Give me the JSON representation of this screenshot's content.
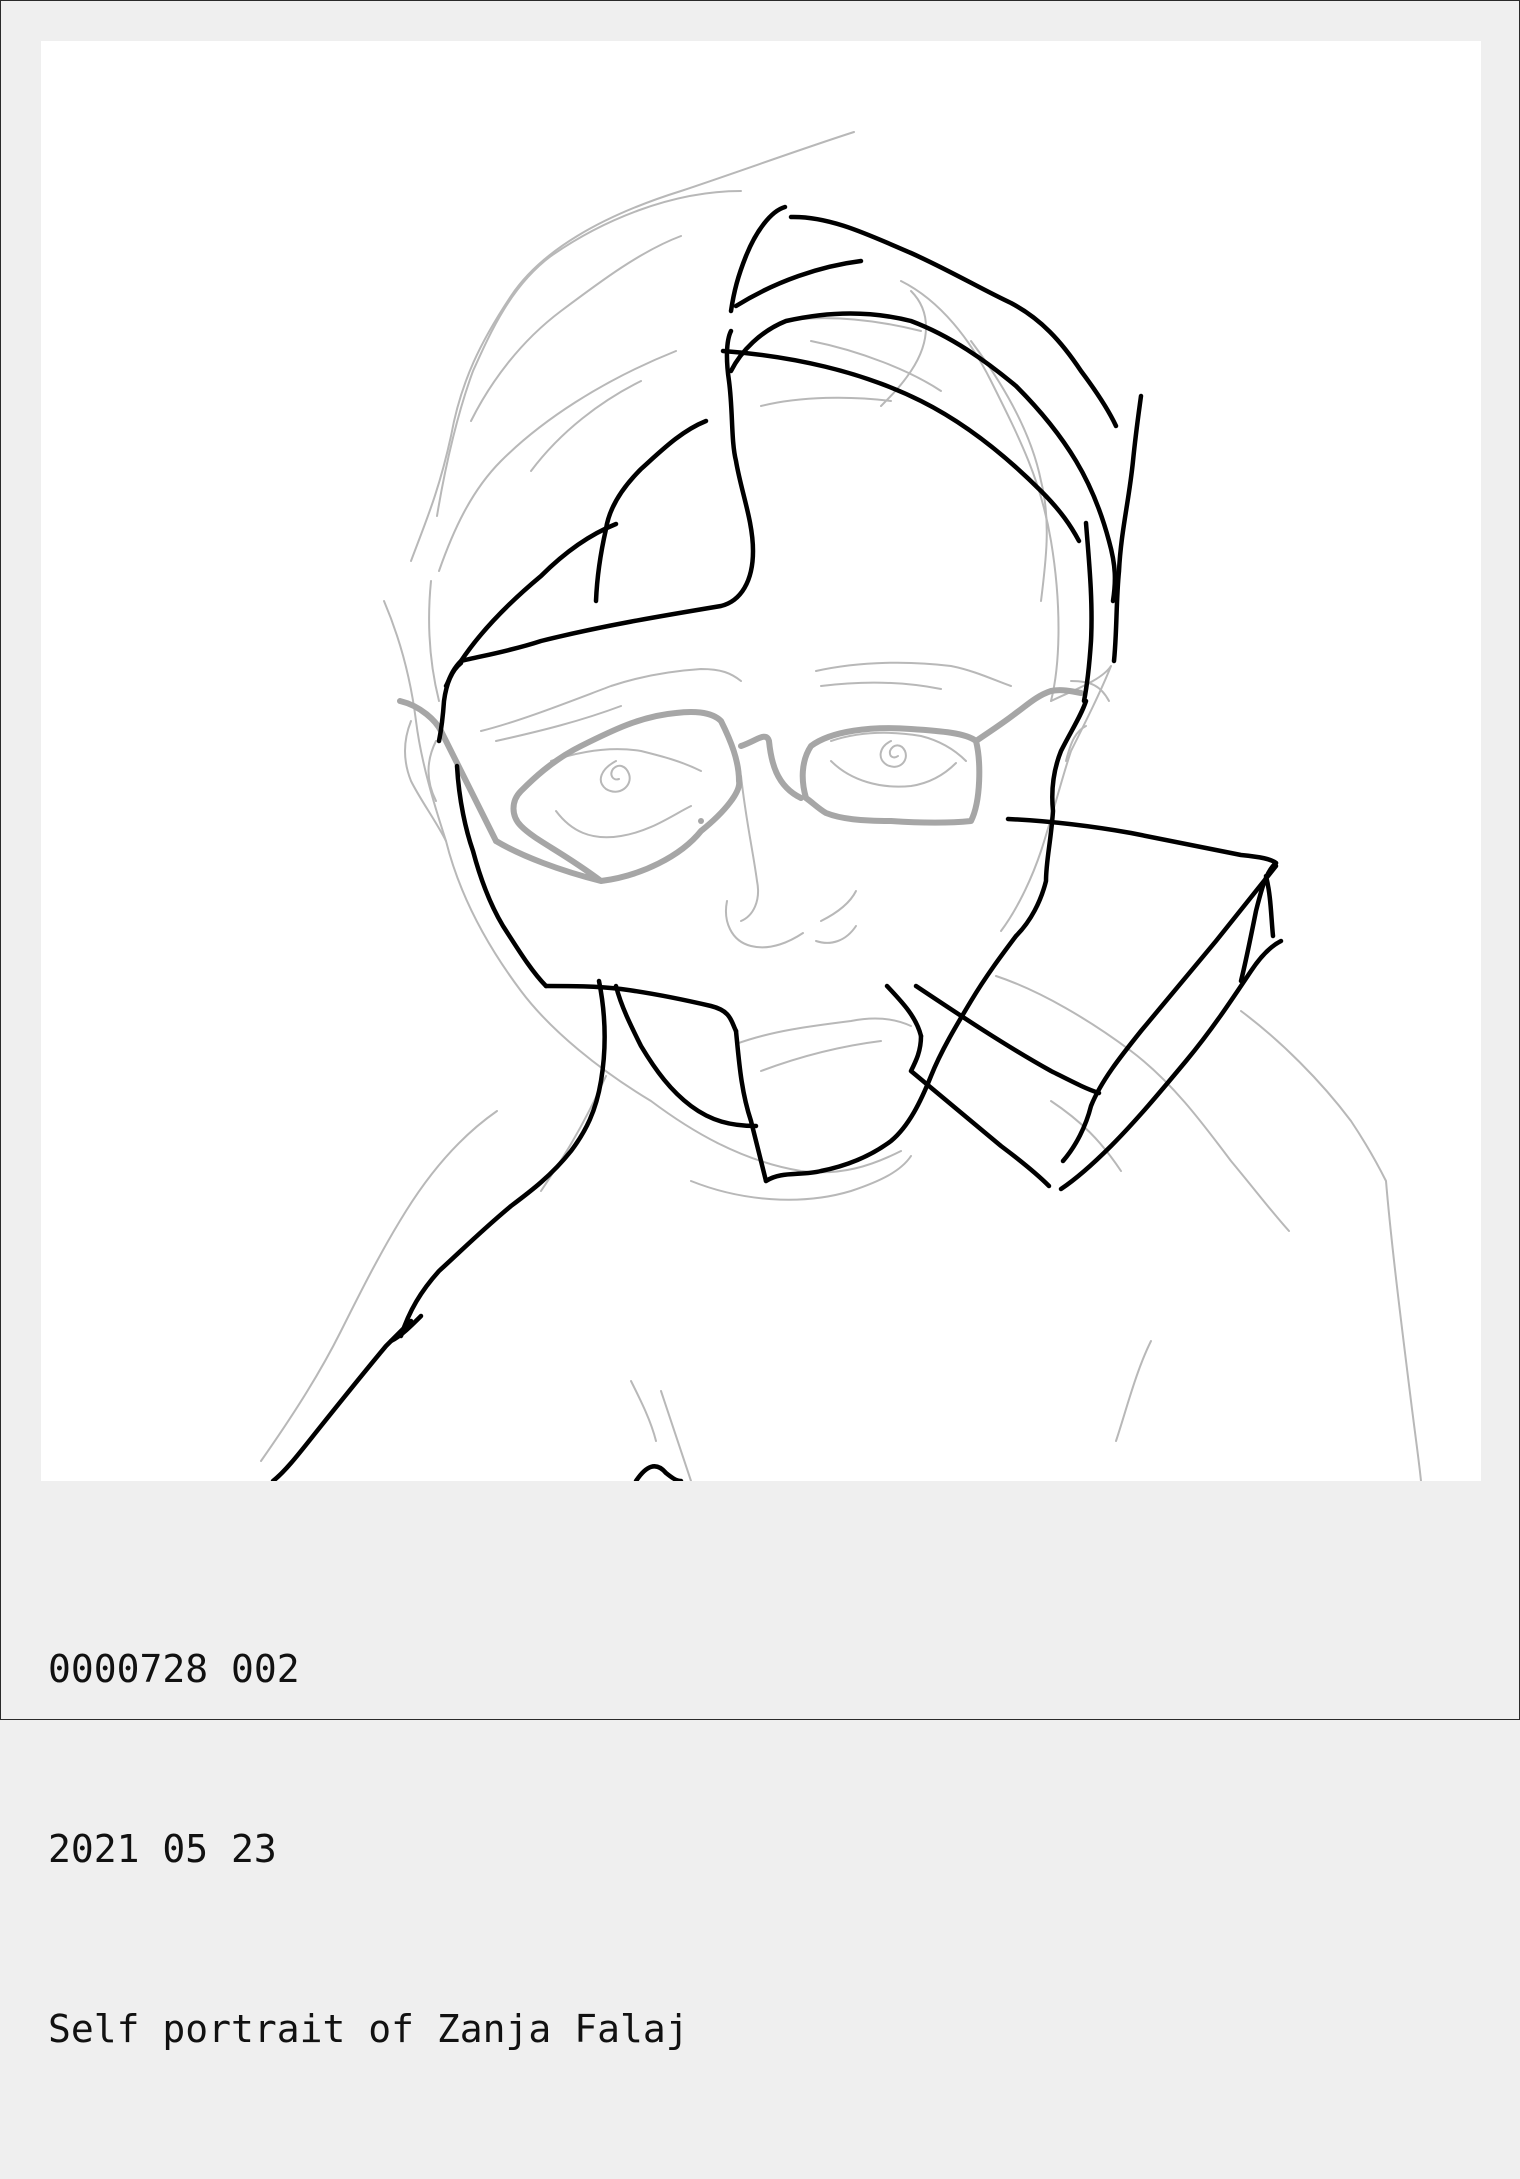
{
  "artwork": {
    "type": "line-drawing",
    "subject_icon": "self-portrait-sketch",
    "colors": {
      "frame_background": "#efefef",
      "canvas_background": "#ffffff",
      "ink_primary": "#000000",
      "ink_sketch": "#b8b8b8",
      "ink_glasses": "#a6a6a6"
    }
  },
  "caption": {
    "id_line": "0000728 002",
    "date_line": "2021 05 23",
    "title_line": "Self portrait of Zanja Falaj"
  }
}
